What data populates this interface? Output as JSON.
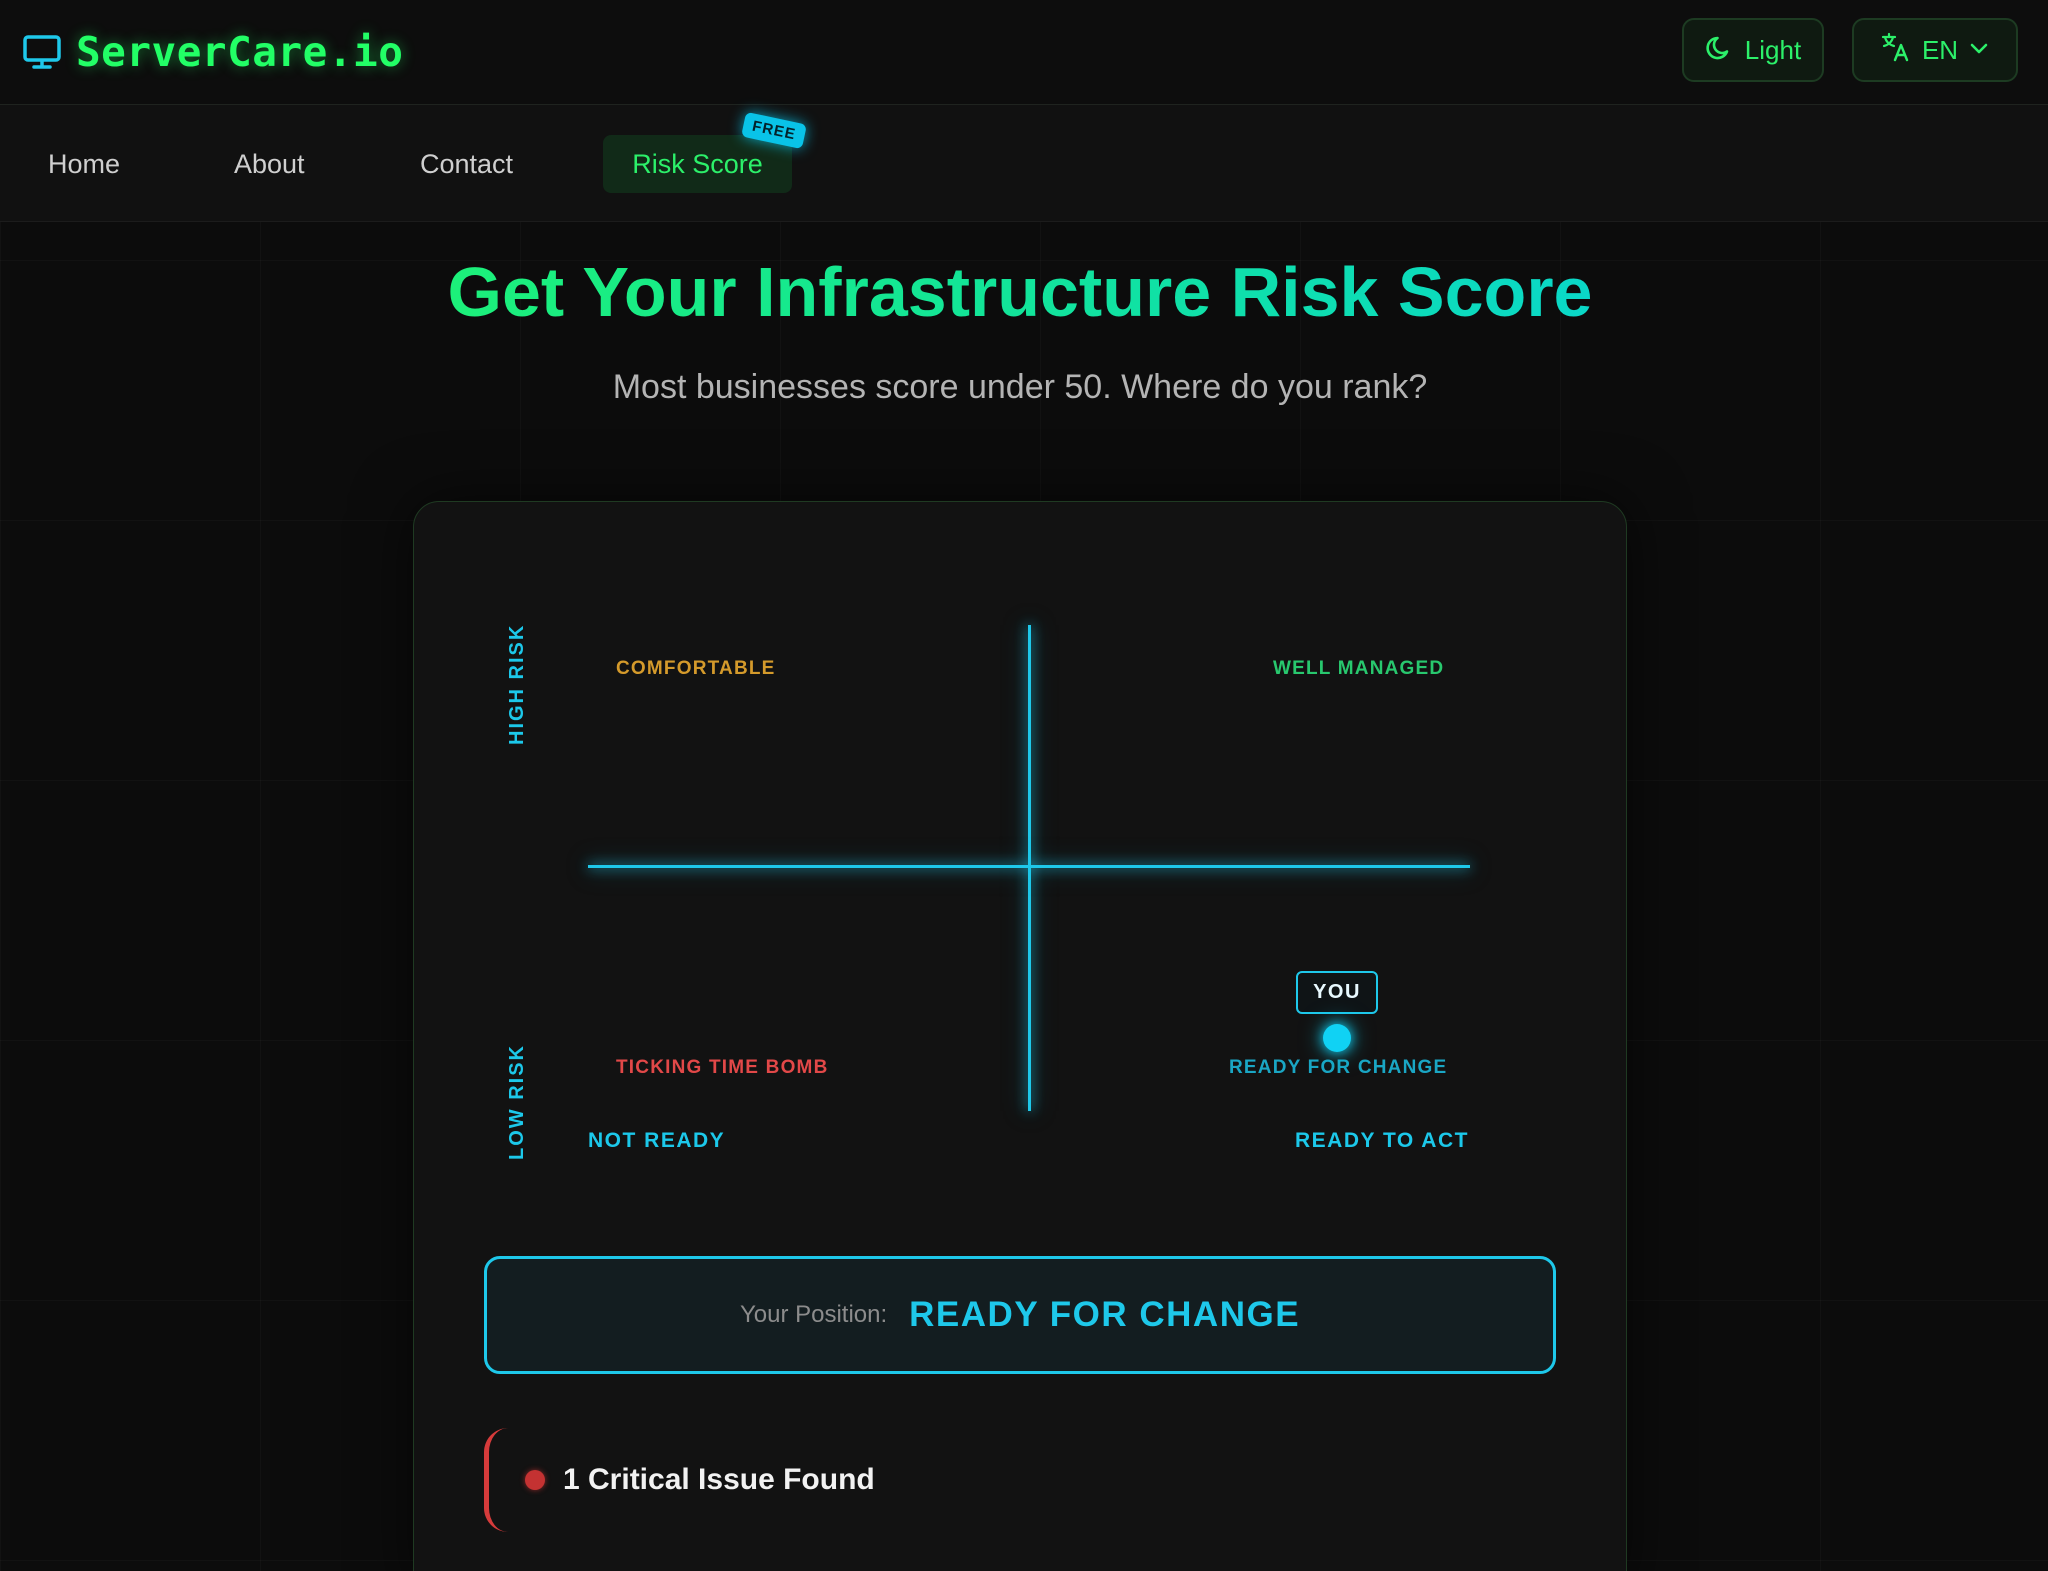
{
  "header": {
    "brand": "ServerCare.io",
    "brand_icon": "monitor-icon",
    "theme_toggle_label": "Light",
    "theme_icon": "moon-icon",
    "language_label": "EN",
    "language_icon": "translate-icon"
  },
  "nav": {
    "items": [
      {
        "label": "Home"
      },
      {
        "label": "About"
      },
      {
        "label": "Contact"
      },
      {
        "label": "Risk Score",
        "active": true
      }
    ],
    "badge": "FREE"
  },
  "hero": {
    "title": "Get Your Infrastructure Risk Score",
    "subtitle": "Most businesses score under 50. Where do you rank?"
  },
  "matrix": {
    "y_axis": {
      "top": "HIGH RISK",
      "bottom": "LOW RISK"
    },
    "x_axis": {
      "left": "NOT READY",
      "right": "READY TO ACT"
    },
    "quadrants": {
      "top_left": "COMFORTABLE",
      "top_right": "WELL MANAGED",
      "bottom_left": "TICKING TIME BOMB",
      "bottom_right": "READY FOR CHANGE"
    },
    "marker_label": "YOU",
    "colors": {
      "axis": "#1ec8ea",
      "comfortable": "#d49a2b",
      "well_managed": "#28c86e",
      "ticking_time_bomb": "#e24848",
      "ready_for_change": "#1aa6c4"
    }
  },
  "result": {
    "position_label": "Your Position:",
    "position_value": "READY FOR CHANGE"
  },
  "issues": {
    "summary": "1 Critical Issue Found"
  }
}
